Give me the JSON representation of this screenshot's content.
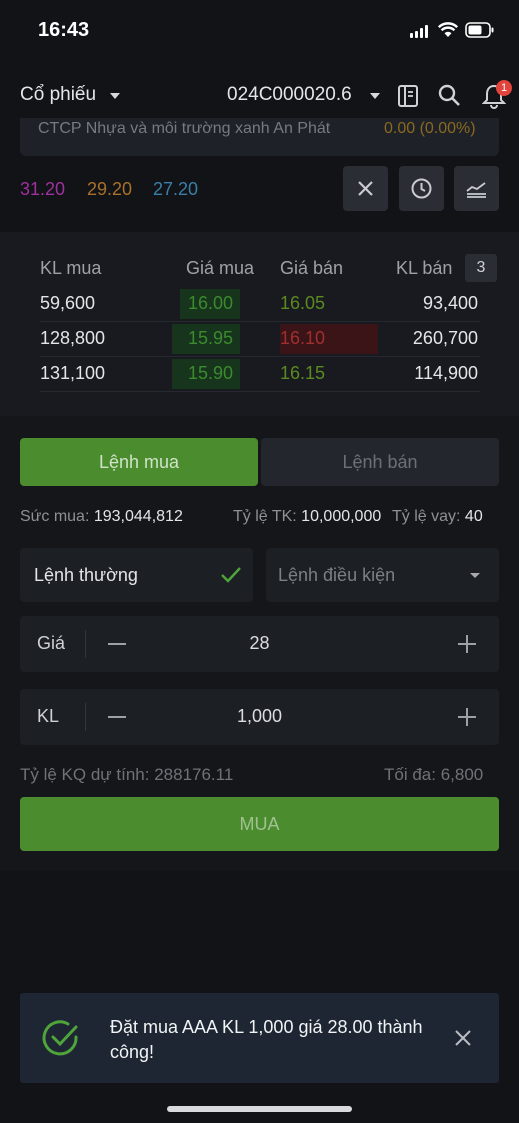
{
  "status_bar": {
    "time": "16:43"
  },
  "header": {
    "title": "Cổ phiếu",
    "account": "024C000020.6",
    "notification_count": "1"
  },
  "stock": {
    "name": "CTCP Nhựa và môi trường xanh An Phát",
    "change": "0.00 (0.00%)",
    "prices": {
      "ceiling": "31.20",
      "reference": "29.20",
      "floor": "27.20"
    }
  },
  "order_book": {
    "headers": {
      "kl_mua": "KL mua",
      "gia_mua": "Giá mua",
      "gia_ban": "Giá bán",
      "kl_ban": "KL bán"
    },
    "levels": "3",
    "rows": [
      {
        "kl_mua": "59,600",
        "gia_mua": "16.00",
        "gia_ban": "16.05",
        "kl_ban": "93,400"
      },
      {
        "kl_mua": "128,800",
        "gia_mua": "15.95",
        "gia_ban": "16.10",
        "kl_ban": "260,700"
      },
      {
        "kl_mua": "131,100",
        "gia_mua": "15.90",
        "gia_ban": "16.15",
        "kl_ban": "114,900"
      }
    ]
  },
  "order_form": {
    "tab_buy": "Lệnh mua",
    "tab_sell": "Lệnh bán",
    "suc_mua_label": "Sức mua:",
    "suc_mua_value": "193,044,812",
    "ty_le_tk_label": "Tỷ lệ TK:",
    "ty_le_tk_value": "10,000,000",
    "ty_le_vay_label": "Tỷ lệ vay:",
    "ty_le_vay_value": "40",
    "order_type_normal": "Lệnh thường",
    "order_type_conditional": "Lệnh điều kiện",
    "price_label": "Giá",
    "price_value": "28",
    "qty_label": "KL",
    "qty_value": "1,000",
    "ratio_text": "Tỷ lệ KQ dự tính: 288176.11",
    "max_text": "Tối đa: 6,800",
    "submit_label": "MUA"
  },
  "toast": {
    "message": "Đặt mua AAA KL 1,000 giá 28.00 thành công!"
  },
  "colors": {
    "accent_green": "#4b8c2f",
    "ceiling": "#a0309e",
    "reference": "#a8702a",
    "floor": "#3b7fa8"
  }
}
